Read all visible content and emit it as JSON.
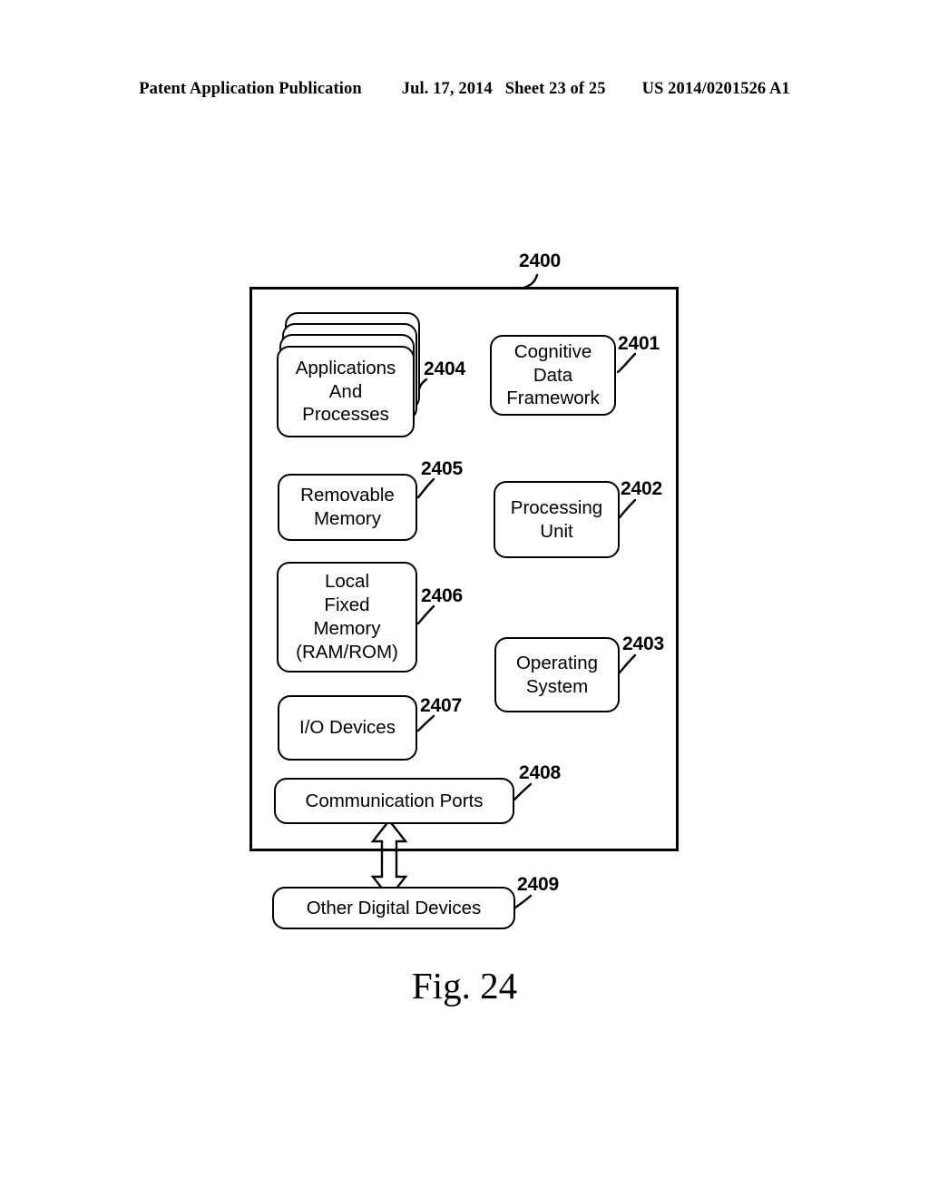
{
  "header": {
    "publication": "Patent Application Publication",
    "date": "Jul. 17, 2014",
    "sheet": "Sheet 23 of 25",
    "patent_number": "US 2014/0201526 A1"
  },
  "figure": {
    "caption": "Fig. 24",
    "system_ref": "2400",
    "nodes": [
      {
        "ref": "2404",
        "name": "applications-and-processes",
        "lines": [
          "Applications",
          "And",
          "Processes"
        ],
        "stacked": true,
        "stack_count": 3
      },
      {
        "ref": "2401",
        "name": "cognitive-data-framework",
        "lines": [
          "Cognitive",
          "Data",
          "Framework"
        ],
        "stacked": false
      },
      {
        "ref": "2405",
        "name": "removable-memory",
        "lines": [
          "Removable",
          "Memory"
        ],
        "stacked": false
      },
      {
        "ref": "2402",
        "name": "processing-unit",
        "lines": [
          "Processing",
          "Unit"
        ],
        "stacked": false
      },
      {
        "ref": "2406",
        "name": "local-fixed-memory",
        "lines": [
          "Local",
          "Fixed",
          "Memory",
          "(RAM/ROM)"
        ],
        "stacked": false
      },
      {
        "ref": "2403",
        "name": "operating-system",
        "lines": [
          "Operating",
          "System"
        ],
        "stacked": false
      },
      {
        "ref": "2407",
        "name": "io-devices",
        "lines": [
          "I/O Devices"
        ],
        "stacked": false
      },
      {
        "ref": "2408",
        "name": "communication-ports",
        "lines": [
          "Communication Ports"
        ],
        "stacked": false
      },
      {
        "ref": "2409",
        "name": "other-digital-devices",
        "lines": [
          "Other Digital Devices"
        ],
        "stacked": false
      }
    ],
    "connector": {
      "name": "bidirectional-arrow",
      "from": "2408",
      "to": "2409",
      "style": "double-headed"
    },
    "colors": {
      "line": "#000000",
      "fill": "#ffffff"
    }
  }
}
